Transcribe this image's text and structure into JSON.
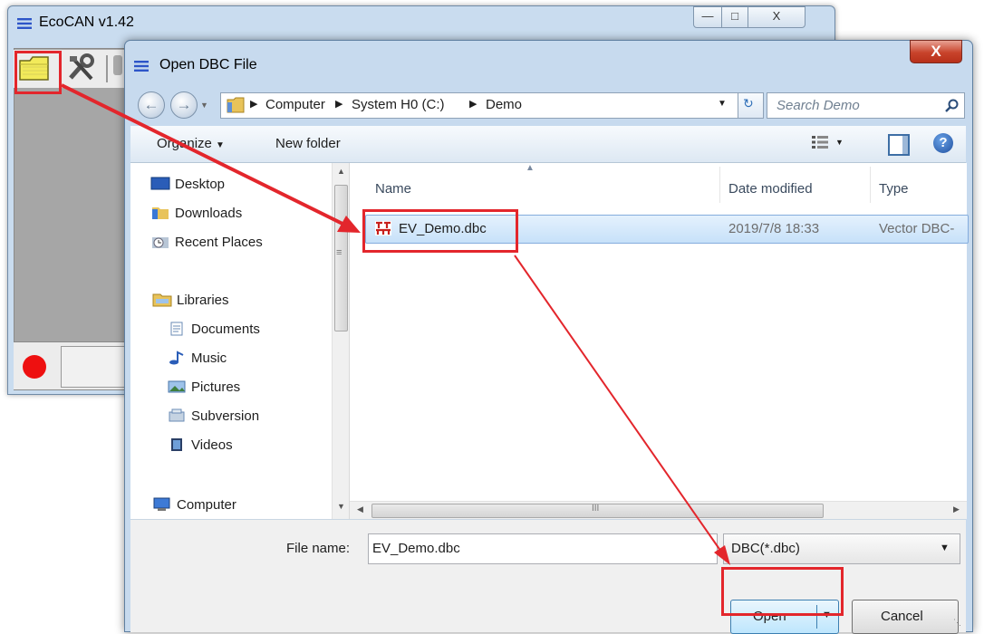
{
  "main_window": {
    "title": "EcoCAN v1.42",
    "minimize_glyph": "—",
    "maximize_glyph": "□",
    "close_glyph": "X"
  },
  "dialog": {
    "title": "Open DBC File",
    "close_glyph": "X",
    "address": {
      "crumbs": [
        "Computer",
        "System H0 (C:)",
        "Demo"
      ]
    },
    "search_placeholder": "Search Demo",
    "commands": {
      "organize": "Organize",
      "new_folder": "New folder"
    },
    "nav_items": [
      {
        "label": "Desktop",
        "icon": "desktop-icon"
      },
      {
        "label": "Downloads",
        "icon": "downloads-icon"
      },
      {
        "label": "Recent Places",
        "icon": "recent-places-icon"
      },
      {
        "label": "Libraries",
        "icon": "libraries-icon"
      },
      {
        "label": "Documents",
        "icon": "documents-icon"
      },
      {
        "label": "Music",
        "icon": "music-icon"
      },
      {
        "label": "Pictures",
        "icon": "pictures-icon"
      },
      {
        "label": "Subversion",
        "icon": "subversion-icon"
      },
      {
        "label": "Videos",
        "icon": "videos-icon"
      },
      {
        "label": "Computer",
        "icon": "computer-icon"
      }
    ],
    "columns": {
      "name": "Name",
      "date_modified": "Date modified",
      "type": "Type"
    },
    "files": [
      {
        "name": "EV_Demo.dbc",
        "date_modified": "2019/7/8 18:33",
        "type": "Vector DBC-"
      }
    ],
    "file_name_label": "File name:",
    "file_name_value": "EV_Demo.dbc",
    "file_type_filter": "DBC(*.dbc)",
    "open_label": "Open",
    "cancel_label": "Cancel",
    "hscroll_glyph": "III",
    "vscroll_glyph": "≡"
  },
  "colors": {
    "annotation_red": "#e3262c",
    "selection_blue": "#cce8ff",
    "window_frame": "#c7daee"
  }
}
